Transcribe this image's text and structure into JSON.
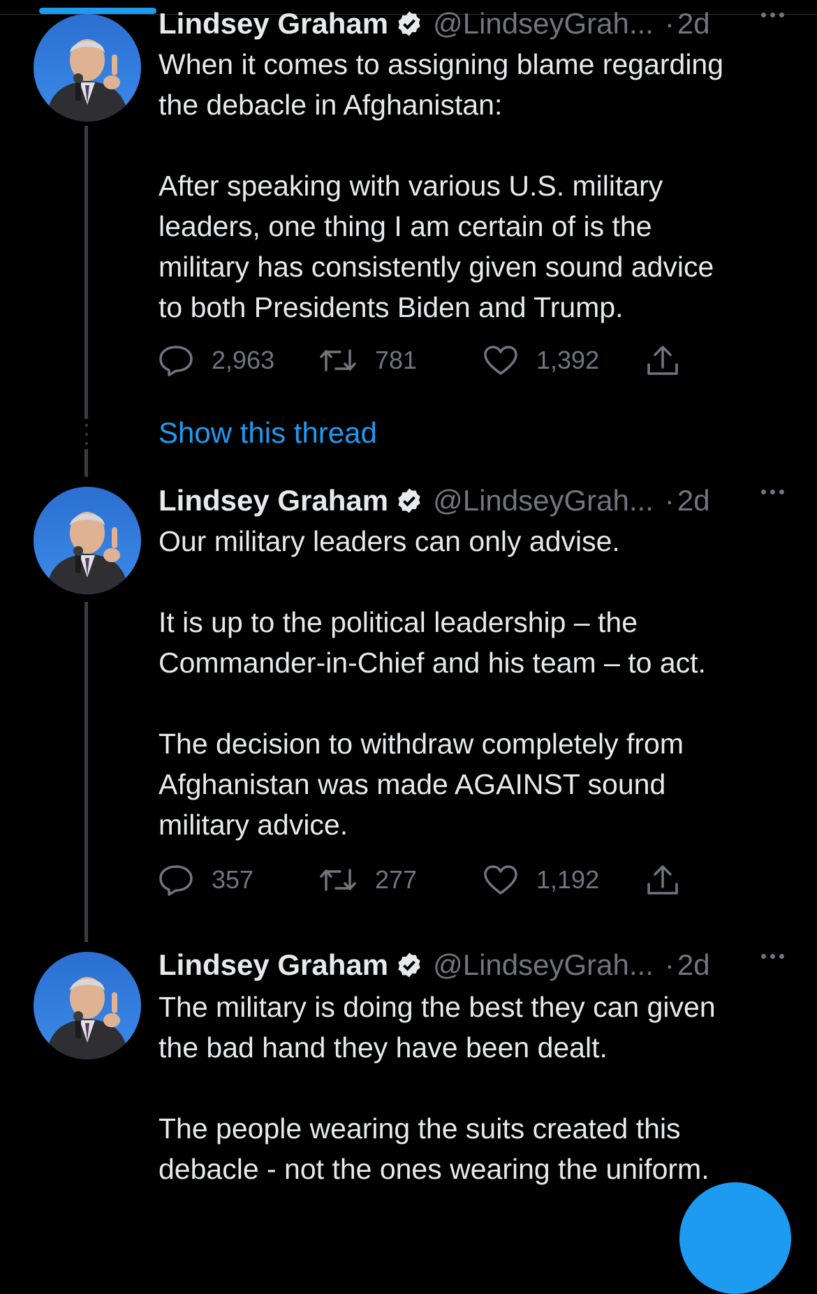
{
  "colors": {
    "background": "#000000",
    "text": "#e7e9ea",
    "secondary": "#71767b",
    "accent": "#1d9bf0",
    "thread_line": "#3a3d40"
  },
  "tweets": [
    {
      "name": "Lindsey Graham",
      "handle": "@LindseyGrah...",
      "separator": "·",
      "time": "2d",
      "text": "When it comes to assigning blame regarding\nthe debacle in Afghanistan:\n\nAfter speaking with various U.S. military\nleaders, one thing I am certain of is the\nmilitary has consistently given sound advice\nto both Presidents Biden and Trump.",
      "replies": "2,963",
      "retweets": "781",
      "likes": "1,392"
    },
    {
      "name": "Lindsey Graham",
      "handle": "@LindseyGrah...",
      "separator": "·",
      "time": "2d",
      "text": "Our military leaders can only advise.\n\nIt is up to the political leadership – the\nCommander-in-Chief and his team – to act.\n\nThe decision to withdraw completely from\nAfghanistan was made AGAINST sound\nmilitary advice.",
      "replies": "357",
      "retweets": "277",
      "likes": "1,192"
    },
    {
      "name": "Lindsey Graham",
      "handle": "@LindseyGrah...",
      "separator": "·",
      "time": "2d",
      "text": "The military is doing the best they can given\nthe bad hand they have been dealt.\n\nThe people wearing the suits created this\ndebacle - not the ones wearing the uniform."
    }
  ],
  "show_thread_label": "Show this thread",
  "icons": {
    "verified": "verified-badge-icon",
    "more": "more-icon",
    "reply": "reply-icon",
    "retweet": "retweet-icon",
    "like": "heart-icon",
    "share": "share-icon"
  }
}
